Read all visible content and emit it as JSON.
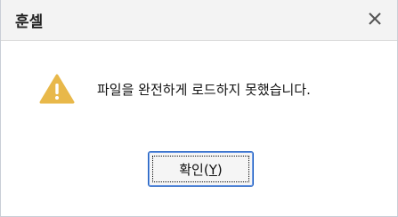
{
  "window": {
    "title": "훈셀",
    "close_glyph": "✕"
  },
  "dialog": {
    "icon": "warning-icon",
    "message": "파일을 완전하게 로드하지 못했습니다.",
    "button_prefix": "확인(",
    "button_mnemonic": "Y",
    "button_suffix": ")"
  },
  "colors": {
    "titlebar_bg": "#f3f3f3",
    "warning": "#e8b84a",
    "button_border": "#1f5fbf"
  }
}
